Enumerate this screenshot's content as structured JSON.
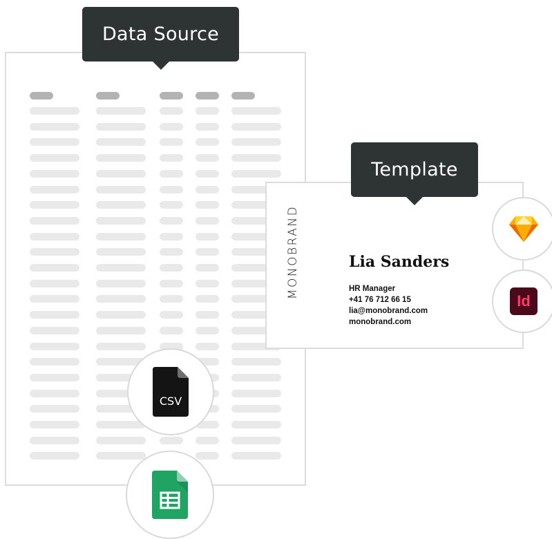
{
  "tooltips": {
    "data_source": "Data Source",
    "template": "Template"
  },
  "card": {
    "brand": "MONOBRAND",
    "name": "Lia Sanders",
    "title": "HR Manager",
    "phone": "+41 76 712 66 15",
    "email": "lia@monobrand.com",
    "website": "monobrand.com"
  },
  "badges": {
    "csv_label": "CSV",
    "indesign_label": "Id",
    "icons": [
      "sketch-icon",
      "indesign-icon",
      "csv-file-icon",
      "google-sheets-icon"
    ]
  },
  "colors": {
    "tooltip_bg": "#2e3333",
    "header_pill": "#b3b3b3",
    "row_pill": "#e9e9e9",
    "sketch_orange": "#f7a800",
    "indesign_bg": "#4a0a1a",
    "indesign_fg": "#ff3a6e",
    "sheets_green": "#1fa463"
  }
}
